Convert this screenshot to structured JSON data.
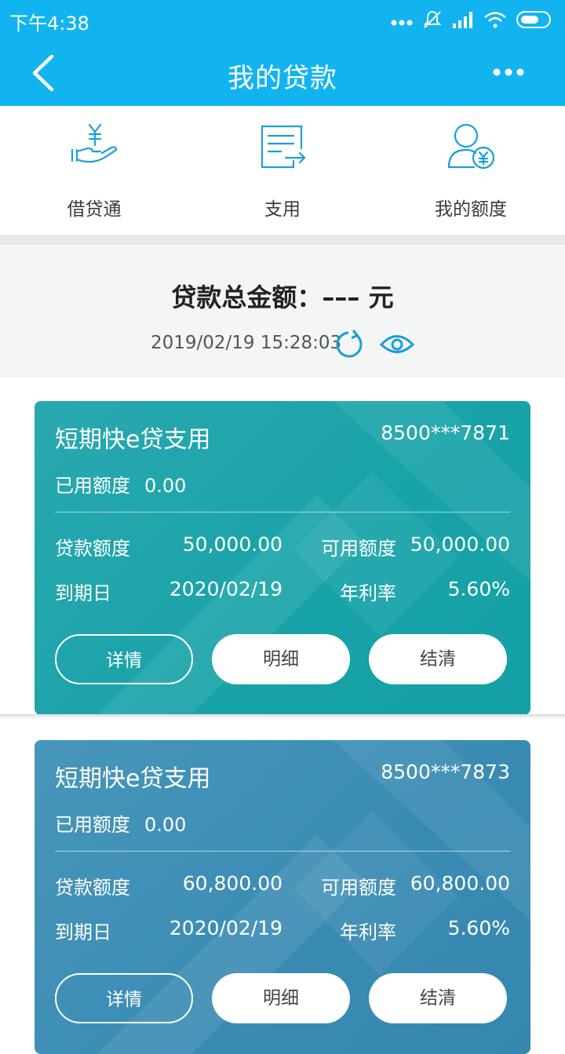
{
  "status_bar": {
    "time": "下午4:38"
  },
  "app_bar": {
    "title": "我的贷款"
  },
  "quick_actions": [
    {
      "label": "借贷通",
      "icon": "hand-yuan-icon"
    },
    {
      "label": "支用",
      "icon": "document-transfer-icon"
    },
    {
      "label": "我的额度",
      "icon": "user-yuan-icon"
    }
  ],
  "summary": {
    "total_label": "贷款总金额：",
    "total_value": "––– 元",
    "timestamp": "2019/02/19 15:28:03"
  },
  "cards": [
    {
      "name": "短期快e贷支用",
      "account": "8500***7871",
      "used_label": "已用额度",
      "used_value": "0.00",
      "loan_limit_label": "贷款额度",
      "loan_limit_value": "50,000.00",
      "available_label": "可用额度",
      "available_value": "50,000.00",
      "due_label": "到期日",
      "due_value": "2020/02/19",
      "rate_label": "年利率",
      "rate_value": "5.60%",
      "buttons": [
        "详情",
        "明细",
        "结清"
      ],
      "color": "#1aa5ab"
    },
    {
      "name": "短期快e贷支用",
      "account": "8500***7873",
      "used_label": "已用额度",
      "used_value": "0.00",
      "loan_limit_label": "贷款额度",
      "loan_limit_value": "60,800.00",
      "available_label": "可用额度",
      "available_value": "60,800.00",
      "due_label": "到期日",
      "due_value": "2020/02/19",
      "rate_label": "年利率",
      "rate_value": "5.60%",
      "buttons": [
        "详情",
        "明细",
        "结清"
      ],
      "color": "#3a8bb3"
    }
  ],
  "colors": {
    "brand": "#12b4ef",
    "icon": "#1a9fd8"
  }
}
